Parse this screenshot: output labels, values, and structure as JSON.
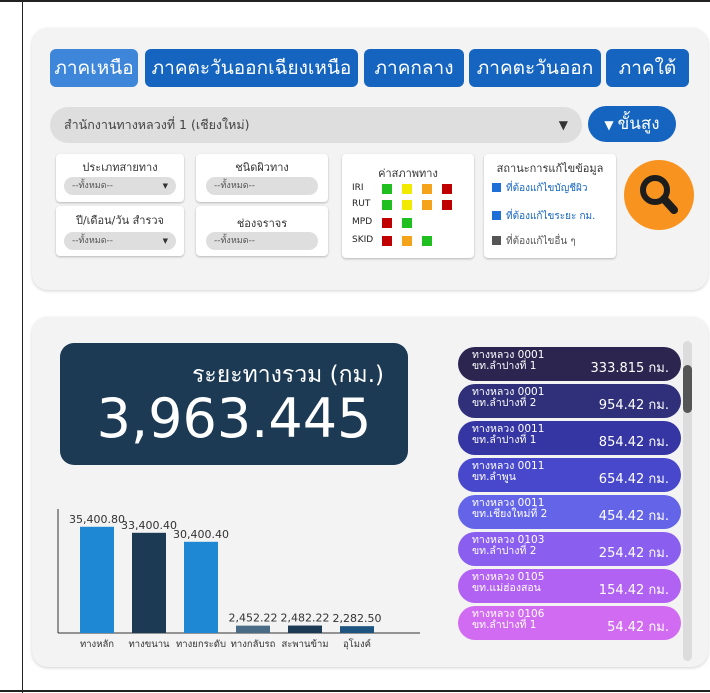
{
  "regions": {
    "tabs": [
      {
        "label": "ภาคเหนือ",
        "active": true
      },
      {
        "label": "ภาคตะวันออกเฉียงเหนือ",
        "active": false
      },
      {
        "label": "ภาคกลาง",
        "active": false
      },
      {
        "label": "ภาคตะวันออก",
        "active": false
      },
      {
        "label": "ภาคใต้",
        "active": false
      }
    ]
  },
  "office_select": {
    "value": "สำนักงานทางหลวงที่ 1 (เชียงใหม่)"
  },
  "advanced_button": {
    "label": "ขั้นสูง"
  },
  "filters": {
    "road_type": {
      "label": "ประเภทสายทาง",
      "value": "--ทั้งหมด--"
    },
    "surface_type": {
      "label": "ชนิดผิวทาง",
      "value": "--ทั้งหมด--"
    },
    "survey_date": {
      "label": "ปี/เดือน/วัน สำรวจ",
      "value": "--ทั้งหมด--"
    },
    "lane": {
      "label": "ช่องจราจร",
      "value": "--ทั้งหมด--"
    }
  },
  "condition": {
    "title": "ค่าสภาพทาง",
    "rows": [
      {
        "label": "IRI",
        "colors": [
          "#1fbf1f",
          "#f2ea00",
          "#f5a31a",
          "#c00000"
        ]
      },
      {
        "label": "RUT",
        "colors": [
          "#1fbf1f",
          "#f2ea00",
          "#f5a31a",
          "#c00000"
        ]
      },
      {
        "label": "MPD",
        "colors": [
          "#c00000",
          "#1fbf1f"
        ]
      },
      {
        "label": "SKID",
        "colors": [
          "#c00000",
          "#f5a31a",
          "#1fbf1f"
        ]
      }
    ]
  },
  "data_status": {
    "title": "สถานะการแก้ไขข้อมูล",
    "items": [
      {
        "label": "ที่ต้องแก้ไขบัญชีผิว",
        "color": "#1e6fd6"
      },
      {
        "label": "ที่ต้องแก้ไขระยะ กม.",
        "color": "#1e6fd6"
      },
      {
        "label": "ที่ต้องแก้ไขอื่น ๆ",
        "color": "#555555"
      }
    ]
  },
  "search_button": {
    "icon": "magnifier-icon"
  },
  "total_distance": {
    "label": "ระยะทางรวม (กม.)",
    "value": "3,963.445"
  },
  "chart_data": {
    "type": "bar",
    "categories": [
      "ทางหลัก",
      "ทางขนาน",
      "ทางยกระดับ",
      "ทางกลับรถ",
      "สะพานข้าม",
      "อุโมงค์"
    ],
    "values": [
      35400.8,
      33400.4,
      30400.4,
      2452.22,
      2482.22,
      2282.5
    ],
    "value_labels": [
      "35,400.80",
      "33,400.40",
      "30,400.40",
      "2,452.22",
      "2,482.22",
      "2,282.50"
    ],
    "colors": [
      "#1e88d4",
      "#1d3a54",
      "#1e88d4",
      "#4a6b86",
      "#1d3a54",
      "#1d5580"
    ],
    "ylim": [
      0,
      40000
    ]
  },
  "routes": [
    {
      "road": "ทางหลวง 0001",
      "section": "ขท.ลำปางที่ 1",
      "length": "333.815 กม.",
      "color": "#2b2550"
    },
    {
      "road": "ทางหลวง 0001",
      "section": "ขท.ลำปางที่ 2",
      "length": "954.42 กม.",
      "color": "#2f2f7a"
    },
    {
      "road": "ทางหลวง 0011",
      "section": "ขท.ลำปางที่ 1",
      "length": "854.42 กม.",
      "color": "#3535a3"
    },
    {
      "road": "ทางหลวง 0011",
      "section": "ขท.ลำพูน",
      "length": "654.42 กม.",
      "color": "#4848cc"
    },
    {
      "road": "ทางหลวง 0011",
      "section": "ขท.เชียงใหม่ที่ 2",
      "length": "454.42 กม.",
      "color": "#6464e8"
    },
    {
      "road": "ทางหลวง 0103",
      "section": "ขท.ลำปางที่ 2",
      "length": "254.42 กม.",
      "color": "#8a5ff0"
    },
    {
      "road": "ทางหลวง 0105",
      "section": "ขท.แม่ฮ่องสอน",
      "length": "154.42 กม.",
      "color": "#b262f2"
    },
    {
      "road": "ทางหลวง 0106",
      "section": "ขท.ลำปางที่ 1",
      "length": "54.42 กม.",
      "color": "#d16cf2"
    }
  ]
}
